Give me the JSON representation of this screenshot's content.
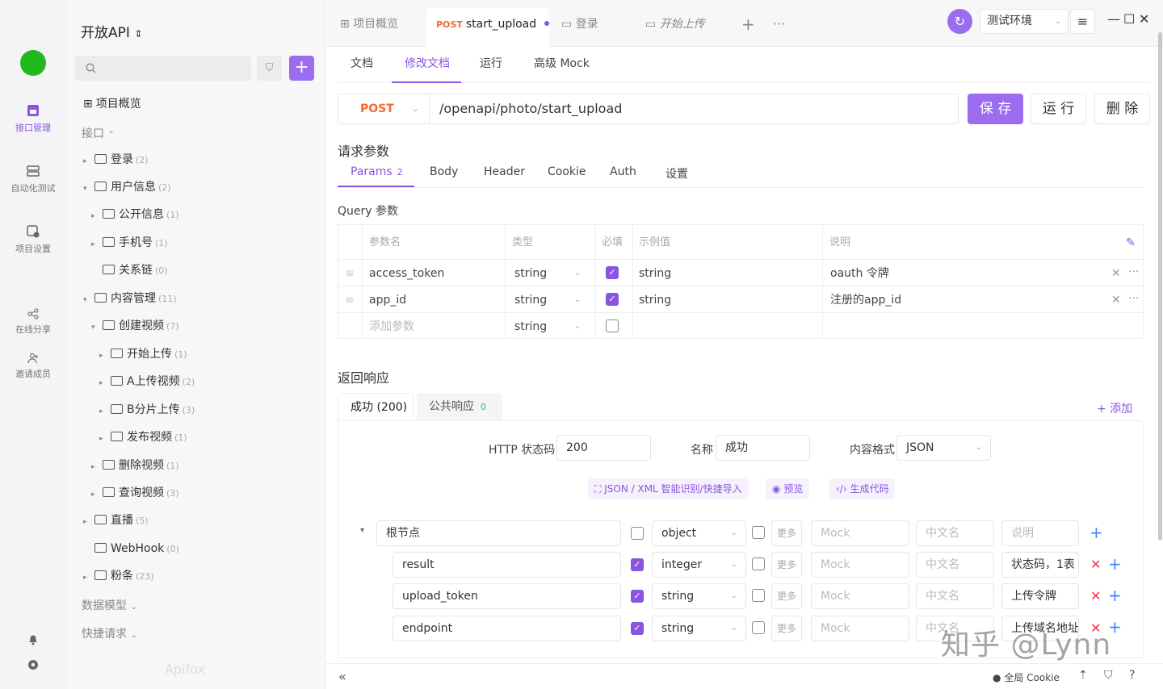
{
  "app": {
    "logo": "Apifox"
  },
  "rail": {
    "items": [
      {
        "label": "接口管理",
        "icon": "api-icon"
      },
      {
        "label": "自动化测试",
        "icon": "test-icon"
      },
      {
        "label": "项目设置",
        "icon": "settings-icon"
      },
      {
        "label": "在线分享",
        "icon": "share-icon"
      },
      {
        "label": "邀请成员",
        "icon": "invite-icon"
      }
    ]
  },
  "sidebar": {
    "project_title": "开放API",
    "overview": "项目概览",
    "section_api": "接口",
    "section_models": "数据模型",
    "section_quick": "快捷请求",
    "tree": [
      {
        "label": "登录",
        "count": "(2)"
      },
      {
        "label": "用户信息",
        "count": "(2)"
      },
      {
        "label": "公开信息",
        "count": "(1)"
      },
      {
        "label": "手机号",
        "count": "(1)"
      },
      {
        "label": "关系链",
        "count": "(0)"
      },
      {
        "label": "内容管理",
        "count": "(11)"
      },
      {
        "label": "创建视频",
        "count": "(7)"
      },
      {
        "label": "开始上传",
        "count": "(1)"
      },
      {
        "label": "A上传视频",
        "count": "(2)"
      },
      {
        "label": "B分片上传",
        "count": "(3)"
      },
      {
        "label": "发布视频",
        "count": "(1)"
      },
      {
        "label": "删除视频",
        "count": "(1)"
      },
      {
        "label": "查询视频",
        "count": "(3)"
      },
      {
        "label": "直播",
        "count": "(5)"
      },
      {
        "label": "WebHook",
        "count": "(0)"
      },
      {
        "label": "粉条",
        "count": "(23)"
      }
    ]
  },
  "tabs": [
    {
      "label": "项目概览"
    },
    {
      "method": "POST",
      "label": "start_upload"
    },
    {
      "label": "登录"
    },
    {
      "label": "开始上传"
    }
  ],
  "env": {
    "label": "测试环境"
  },
  "subtabs": [
    "文档",
    "修改文档",
    "运行",
    "高级 Mock"
  ],
  "request": {
    "method": "POST",
    "url": "/openapi/photo/start_upload",
    "save": "保 存",
    "run": "运 行",
    "delete": "删 除"
  },
  "params_section": {
    "title": "请求参数",
    "tabs": [
      "Params",
      "Body",
      "Header",
      "Cookie",
      "Auth",
      "设置"
    ],
    "params_badge": "2",
    "query_title": "Query 参数",
    "headers": [
      "参数名",
      "类型",
      "必填",
      "示例值",
      "说明"
    ],
    "rows": [
      {
        "name": "access_token",
        "type": "string",
        "required": true,
        "example": "string",
        "desc": "oauth 令牌"
      },
      {
        "name": "app_id",
        "type": "string",
        "required": true,
        "example": "string",
        "desc": "注册的app_id"
      }
    ],
    "add_placeholder": "添加参数",
    "add_type": "string"
  },
  "response": {
    "title": "返回响应",
    "tab_ok": "成功 (200)",
    "tab_public": "公共响应",
    "tab_public_badge": "0",
    "add": "+ 添加",
    "status_label": "HTTP 状态码:",
    "status_value": "200",
    "name_label": "名称",
    "name_value": "成功",
    "format_label": "内容格式",
    "format_value": "JSON",
    "pill_import": "JSON / XML 智能识别/快捷导入",
    "pill_preview": "预览",
    "pill_code": "生成代码",
    "more": "更多",
    "mock_ph": "Mock",
    "cn_ph": "中文名",
    "desc_ph": "说明",
    "fields": [
      {
        "name": "根节点",
        "type": "object",
        "required": false,
        "desc": ""
      },
      {
        "name": "result",
        "type": "integer",
        "required": true,
        "desc": "状态码，1表"
      },
      {
        "name": "upload_token",
        "type": "string",
        "required": true,
        "desc": "上传令牌"
      },
      {
        "name": "endpoint",
        "type": "string",
        "required": true,
        "desc": "上传域名地址"
      }
    ]
  },
  "bottom": {
    "cookie": "全局 Cookie"
  },
  "watermark": "知乎 @Lynn"
}
